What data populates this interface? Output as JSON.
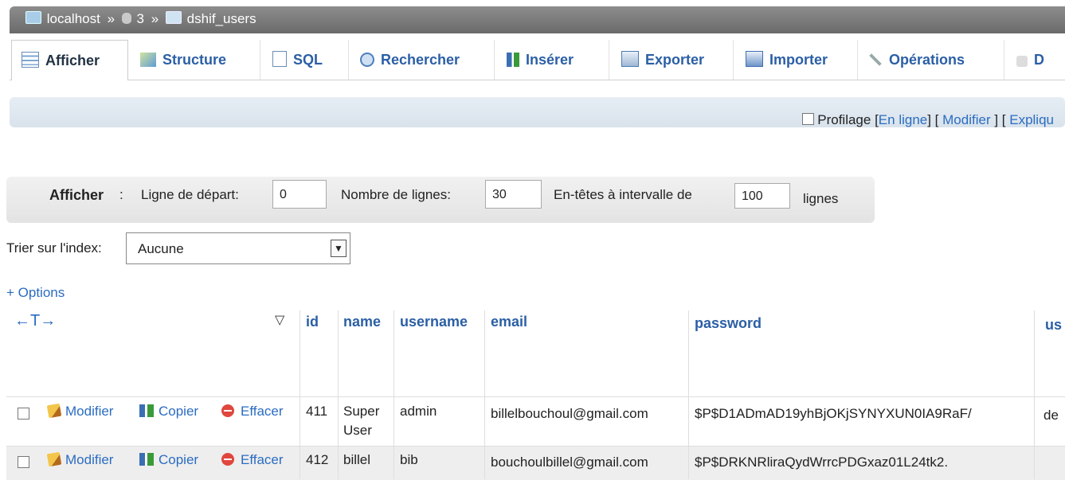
{
  "breadcrumb": {
    "server": "localhost",
    "database": "3",
    "table": "dshif_users",
    "separator": "»"
  },
  "tabs": [
    {
      "label": "Afficher",
      "icon": "browse-icon"
    },
    {
      "label": "Structure",
      "icon": "structure-icon"
    },
    {
      "label": "SQL",
      "icon": "sql-icon"
    },
    {
      "label": "Rechercher",
      "icon": "search-icon"
    },
    {
      "label": "Insérer",
      "icon": "insert-icon"
    },
    {
      "label": "Exporter",
      "icon": "export-icon"
    },
    {
      "label": "Importer",
      "icon": "import-icon"
    },
    {
      "label": "Opérations",
      "icon": "operations-icon"
    },
    {
      "label": "D",
      "icon": "more-icon"
    }
  ],
  "profiling": {
    "label": "Profilage",
    "inline_link": "En ligne",
    "edit_link": "Modifier",
    "explain_link": "Expliqu"
  },
  "navigation": {
    "title": "Afficher",
    "colon": ":",
    "start_label": "Ligne de départ:",
    "start_value": "0",
    "rows_label": "Nombre de lignes:",
    "rows_value": "30",
    "headers_label": "En-têtes à intervalle de",
    "headers_value": "100",
    "lines_label": "lignes"
  },
  "sort": {
    "label": "Trier sur l'index:",
    "value": "Aucune"
  },
  "options_link": "+ Options",
  "arrows": "←T→",
  "columns": [
    "id",
    "name",
    "username",
    "email",
    "password",
    "us"
  ],
  "actions": {
    "edit": "Modifier",
    "copy": "Copier",
    "delete": "Effacer"
  },
  "rows": [
    {
      "id": "411",
      "name_line1": "Super",
      "name_line2": "User",
      "username": "admin",
      "email": "billelbouchoul@gmail.com",
      "password": "$P$D1ADmAD19yhBjOKjSYNYXUN0IA9RaF/",
      "extra": "de"
    },
    {
      "id": "412",
      "name_line1": "billel",
      "name_line2": "",
      "username": "bib",
      "email": "bouchoulbillel@gmail.com",
      "password": "$P$DRKNRliraQydWrrcPDGxaz01L24tk2.",
      "extra": ""
    }
  ]
}
